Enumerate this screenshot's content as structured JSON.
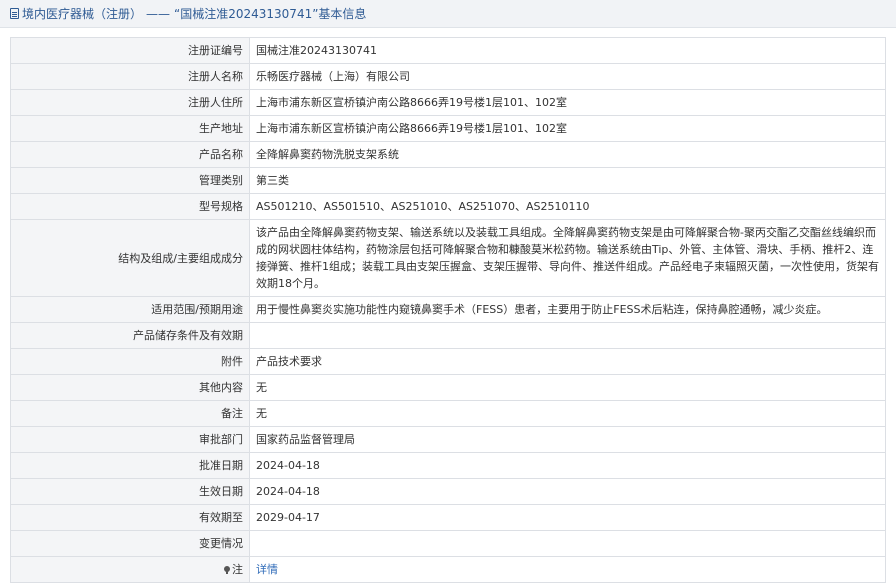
{
  "header": {
    "category": "境内医疗器械（注册）",
    "separator": "——",
    "title": "“国械注准20243130741”基本信息"
  },
  "rows": [
    {
      "label": "注册证编号",
      "value": "国械注准20243130741"
    },
    {
      "label": "注册人名称",
      "value": "乐畅医疗器械（上海）有限公司"
    },
    {
      "label": "注册人住所",
      "value": "上海市浦东新区宣桥镇沪南公路8666弄19号楼1层101、102室"
    },
    {
      "label": "生产地址",
      "value": "上海市浦东新区宣桥镇沪南公路8666弄19号楼1层101、102室"
    },
    {
      "label": "产品名称",
      "value": "全降解鼻窦药物洗脱支架系统"
    },
    {
      "label": "管理类别",
      "value": "第三类"
    },
    {
      "label": "型号规格",
      "value": "AS501210、AS501510、AS251010、AS251070、AS2510110"
    },
    {
      "label": "结构及组成/主要组成成分",
      "value": "该产品由全降解鼻窦药物支架、输送系统以及装载工具组成。全降解鼻窦药物支架是由可降解聚合物-聚丙交酯乙交酯丝线编织而成的网状圆柱体结构，药物涂层包括可降解聚合物和糠酸莫米松药物。输送系统由Tip、外管、主体管、滑块、手柄、推杆2、连接弹簧、推杆1组成；装载工具由支架压握盒、支架压握带、导向件、推送件组成。产品经电子束辐照灭菌，一次性使用，货架有效期18个月。"
    },
    {
      "label": "适用范围/预期用途",
      "value": "用于慢性鼻窦炎实施功能性内窥镜鼻窦手术（FESS）患者，主要用于防止FESS术后粘连，保持鼻腔通畅，减少炎症。"
    },
    {
      "label": "产品储存条件及有效期",
      "value": ""
    },
    {
      "label": "附件",
      "value": "产品技术要求"
    },
    {
      "label": "其他内容",
      "value": "无"
    },
    {
      "label": "备注",
      "value": "无"
    },
    {
      "label": "审批部门",
      "value": "国家药品监督管理局"
    },
    {
      "label": "批准日期",
      "value": "2024-04-18"
    },
    {
      "label": "生效日期",
      "value": "2024-04-18"
    },
    {
      "label": "有效期至",
      "value": "2029-04-17"
    },
    {
      "label": "变更情况",
      "value": ""
    }
  ],
  "note": {
    "label": "注",
    "link_text": "详情"
  }
}
